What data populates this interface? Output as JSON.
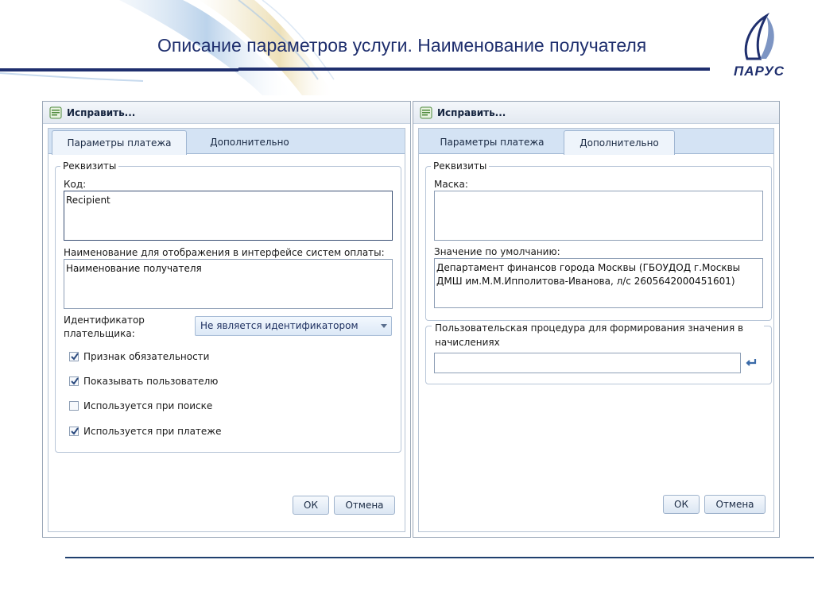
{
  "slide": {
    "title": "Описание параметров услуги. Наименование получателя",
    "logo_text": "ПАРУС",
    "colors": {
      "title": "#1f2f6e",
      "rule": "#1f2f6e"
    }
  },
  "left_dialog": {
    "title": "Исправить...",
    "tabs": [
      {
        "label": "Параметры платежа",
        "active": true
      },
      {
        "label": "Дополнительно",
        "active": false
      }
    ],
    "group_title": "Реквизиты",
    "code_label": "Код:",
    "code_value": "Recipient",
    "display_name_label": "Наименование для отображения в интерфейсе систем оплаты:",
    "display_name_value": "Наименование получателя",
    "identifier_label_line1": "Идентификатор",
    "identifier_label_line2": "плательщика:",
    "identifier_value": "Не является идентификатором",
    "checkboxes": [
      {
        "label": "Признак обязательности",
        "checked": true
      },
      {
        "label": "Показывать пользователю",
        "checked": true
      },
      {
        "label": "Используется при поиске",
        "checked": false
      },
      {
        "label": "Используется при платеже",
        "checked": true
      }
    ],
    "ok_label": "ОК",
    "cancel_label": "Отмена"
  },
  "right_dialog": {
    "title": "Исправить...",
    "tabs": [
      {
        "label": "Параметры платежа",
        "active": false
      },
      {
        "label": "Дополнительно",
        "active": true
      }
    ],
    "group_title": "Реквизиты",
    "mask_label": "Маска:",
    "mask_value": "",
    "default_label": "Значение по умолчанию:",
    "default_value": "Департамент финансов города Москвы (ГБОУДОД г.Москвы\nДМШ им.М.М.Ипполитова-Иванова, л/с 2605642000451601)",
    "procedure_group_title": "Пользовательская процедура для формирования значения в начислениях",
    "procedure_value": "",
    "ok_label": "ОК",
    "cancel_label": "Отмена"
  }
}
